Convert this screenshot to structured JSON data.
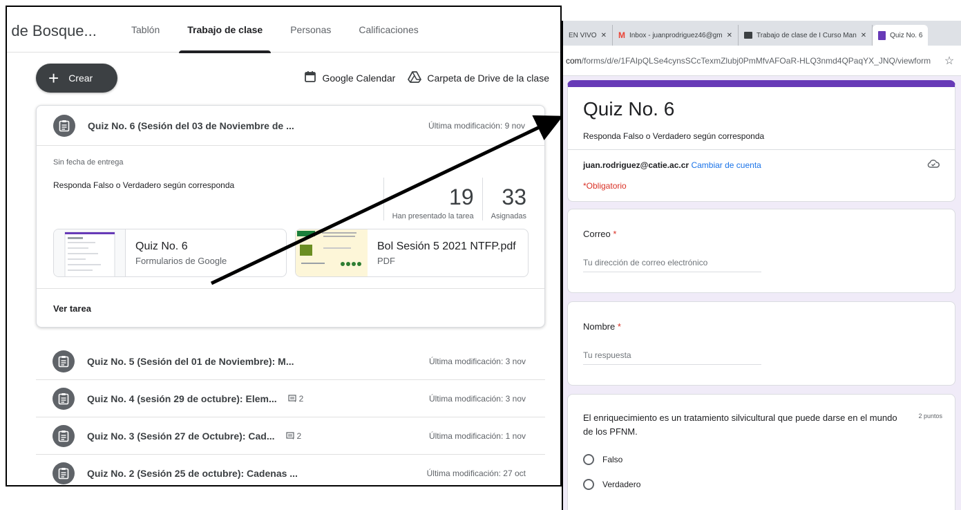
{
  "classroom": {
    "course_title": "o de Bosque...",
    "tabs": [
      "Tablón",
      "Trabajo de clase",
      "Personas",
      "Calificaciones"
    ],
    "create_label": "Crear",
    "calendar_label": "Google Calendar",
    "drive_label": "Carpeta de Drive de la clase",
    "expanded": {
      "title": "Quiz No. 6 (Sesión del 03 de Noviembre de ...",
      "modified": "Última modificación: 9 nov",
      "due": "Sin fecha de entrega",
      "instructions": "Responda Falso o Verdadero según corresponda",
      "turned_in": "19",
      "turned_in_label": "Han presentado la tarea",
      "assigned": "33",
      "assigned_label": "Asignadas",
      "attachments": [
        {
          "title": "Quiz No. 6",
          "subtitle": "Formularios de Google"
        },
        {
          "title": "Bol Sesión 5 2021 NTFP.pdf",
          "subtitle": "PDF"
        }
      ],
      "view_label": "Ver tarea"
    },
    "items": [
      {
        "title": "Quiz No. 5 (Sesión del 01 de Noviembre): M...",
        "comments": "",
        "modified": "Última modificación: 3 nov"
      },
      {
        "title": "Quiz No. 4 (sesión 29 de octubre): Elem...",
        "comments": "2",
        "modified": "Última modificación: 3 nov"
      },
      {
        "title": "Quiz No. 3 (Sesión 27 de Octubre): Cad...",
        "comments": "2",
        "modified": "Última modificación: 1 nov"
      },
      {
        "title": "Quiz No. 2 (Sesión 25 de octubre): Cadenas ...",
        "comments": "",
        "modified": "Última modificación: 27 oct"
      }
    ]
  },
  "browser": {
    "tabs": [
      {
        "label": "EN VIVO",
        "icon": "close-icon",
        "active": false
      },
      {
        "label": "Inbox - juanprodriguez46@gm",
        "icon": "gmail-icon",
        "active": false
      },
      {
        "label": "Trabajo de clase de I Curso Man",
        "icon": "classroom-icon",
        "active": false
      },
      {
        "label": "Quiz No. 6",
        "icon": "forms-icon",
        "active": true
      }
    ],
    "url_prefix": "com",
    "url_path": "/forms/d/e/1FAIpQLSe4cynsSCcTexmZlubj0PmMfvAFOaR-HLQ3nmd4QPaqYX_JNQ/viewform"
  },
  "form": {
    "title": "Quiz No. 6",
    "description": "Responda Falso o Verdadero según corresponda",
    "account": "juan.rodriguez@catie.ac.cr",
    "switch_account": "Cambiar de cuenta",
    "required_note": "*Obligatorio",
    "questions": [
      {
        "label": "Correo",
        "placeholder": "Tu dirección de correo electrónico"
      },
      {
        "label": "Nombre",
        "placeholder": "Tu respuesta"
      }
    ],
    "mc_question": "El enriquecimiento es un tratamiento silvicultural que puede darse en el mundo de los PFNM.",
    "points": "2 puntos",
    "options": [
      "Falso",
      "Verdadero"
    ],
    "accent_color": "#673ab7",
    "background_color": "#f0ebf8"
  }
}
